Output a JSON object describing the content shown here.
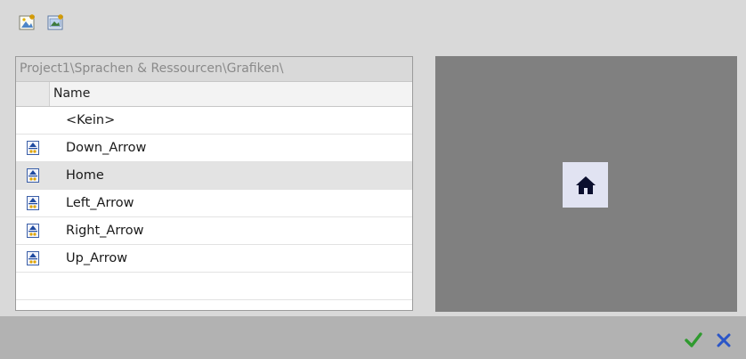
{
  "toolbar": {
    "buttons": [
      {
        "icon": "new-graphic-icon"
      },
      {
        "icon": "add-graphic-from-file-icon"
      }
    ]
  },
  "list": {
    "path": "Project1\\Sprachen & Ressourcen\\Grafiken\\",
    "column_header": "Name",
    "items": [
      {
        "label": "<Kein>",
        "icon": null,
        "selected": false
      },
      {
        "label": "Down_Arrow",
        "icon": "graphic-file-icon",
        "selected": false
      },
      {
        "label": "Home",
        "icon": "graphic-file-icon",
        "selected": true
      },
      {
        "label": "Left_Arrow",
        "icon": "graphic-file-icon",
        "selected": false
      },
      {
        "label": "Right_Arrow",
        "icon": "graphic-file-icon",
        "selected": false
      },
      {
        "label": "Up_Arrow",
        "icon": "graphic-file-icon",
        "selected": false
      }
    ]
  },
  "preview": {
    "icon": "home-icon",
    "bg_color": "#808080",
    "thumb_color": "#e1e3f2"
  },
  "footer": {
    "ok_icon": "checkmark-icon",
    "cancel_icon": "close-icon",
    "ok_color": "#2f9a2f",
    "cancel_color": "#2a55c8"
  }
}
